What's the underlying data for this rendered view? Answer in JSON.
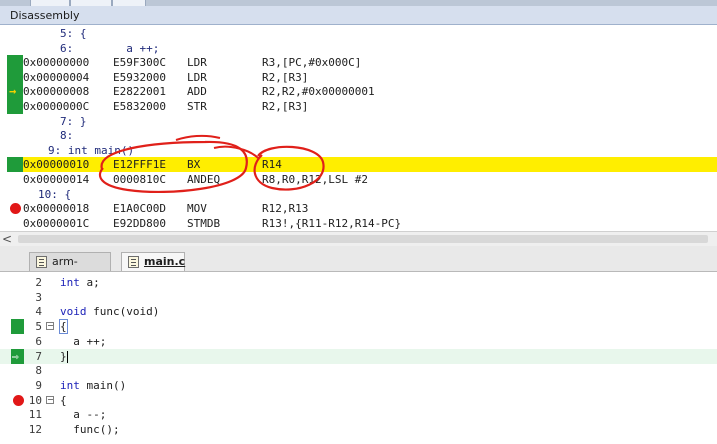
{
  "window": {
    "title": "Disassembly"
  },
  "disassembly": {
    "rows": [
      {
        "kind": "src",
        "text": "5: {"
      },
      {
        "kind": "src",
        "text": "6:        a ++;"
      },
      {
        "kind": "asm",
        "addr": "0x00000000",
        "op": "E59F300C",
        "mn": "LDR",
        "args": "R3,[PC,#0x000C]",
        "marker": "green"
      },
      {
        "kind": "asm",
        "addr": "0x00000004",
        "op": "E5932000",
        "mn": "LDR",
        "args": "R2,[R3]",
        "marker": "green"
      },
      {
        "kind": "asm",
        "addr": "0x00000008",
        "op": "E2822001",
        "mn": "ADD",
        "args": "R2,R2,#0x00000001",
        "marker": "arrow"
      },
      {
        "kind": "asm",
        "addr": "0x0000000C",
        "op": "E5832000",
        "mn": "STR",
        "args": "R2,[R3]",
        "marker": "green"
      },
      {
        "kind": "src",
        "text": "7: }"
      },
      {
        "kind": "src",
        "text": "8:"
      },
      {
        "kind": "src",
        "text": "9: int main()"
      },
      {
        "kind": "asm",
        "addr": "0x00000010",
        "op": "E12FFF1E",
        "mn": "BX",
        "args": "R14",
        "marker": "green",
        "highlight": true
      },
      {
        "kind": "asm",
        "addr": "0x00000014",
        "op": "0000810C",
        "mn": "ANDEQ",
        "args": "R8,R0,R12,LSL #2",
        "marker": ""
      },
      {
        "kind": "src",
        "text": "10: {"
      },
      {
        "kind": "asm",
        "addr": "0x00000018",
        "op": "E1A0C00D",
        "mn": "MOV",
        "args": "R12,R13",
        "marker": "breakpoint"
      },
      {
        "kind": "asm",
        "addr": "0x0000001C",
        "op": "E92DD800",
        "mn": "STMDB",
        "args": "R13!,{R11-R12,R14-PC}",
        "marker": ""
      }
    ]
  },
  "file_tabs": [
    {
      "label": "arm-asm.s",
      "active": false
    },
    {
      "label": "main.c",
      "active": true
    }
  ],
  "editor": {
    "lines": [
      {
        "num": "2",
        "code": "int a;",
        "kw": "int",
        "rest": " a;"
      },
      {
        "num": "3",
        "code": ""
      },
      {
        "num": "4",
        "code": "void func(void)",
        "kw": "void",
        "rest": " func(void)"
      },
      {
        "num": "5",
        "code": "{",
        "fold": "-",
        "marker": "green"
      },
      {
        "num": "6",
        "code": "  a ++;"
      },
      {
        "num": "7",
        "code": "}",
        "marker": "arrow",
        "current": true
      },
      {
        "num": "8",
        "code": ""
      },
      {
        "num": "9",
        "code": "int main()",
        "kw": "int",
        "rest": " main()"
      },
      {
        "num": "10",
        "code": "{",
        "fold": "-",
        "marker": "breakpoint"
      },
      {
        "num": "11",
        "code": "  a --;"
      },
      {
        "num": "12",
        "code": "  func();"
      }
    ]
  },
  "colors": {
    "highlight_line": "#ffee00",
    "executed_marker": "#1f9b3a",
    "breakpoint": "#e11717",
    "annotation_pen": "#e0201a",
    "keyword": "#1d22b8"
  }
}
